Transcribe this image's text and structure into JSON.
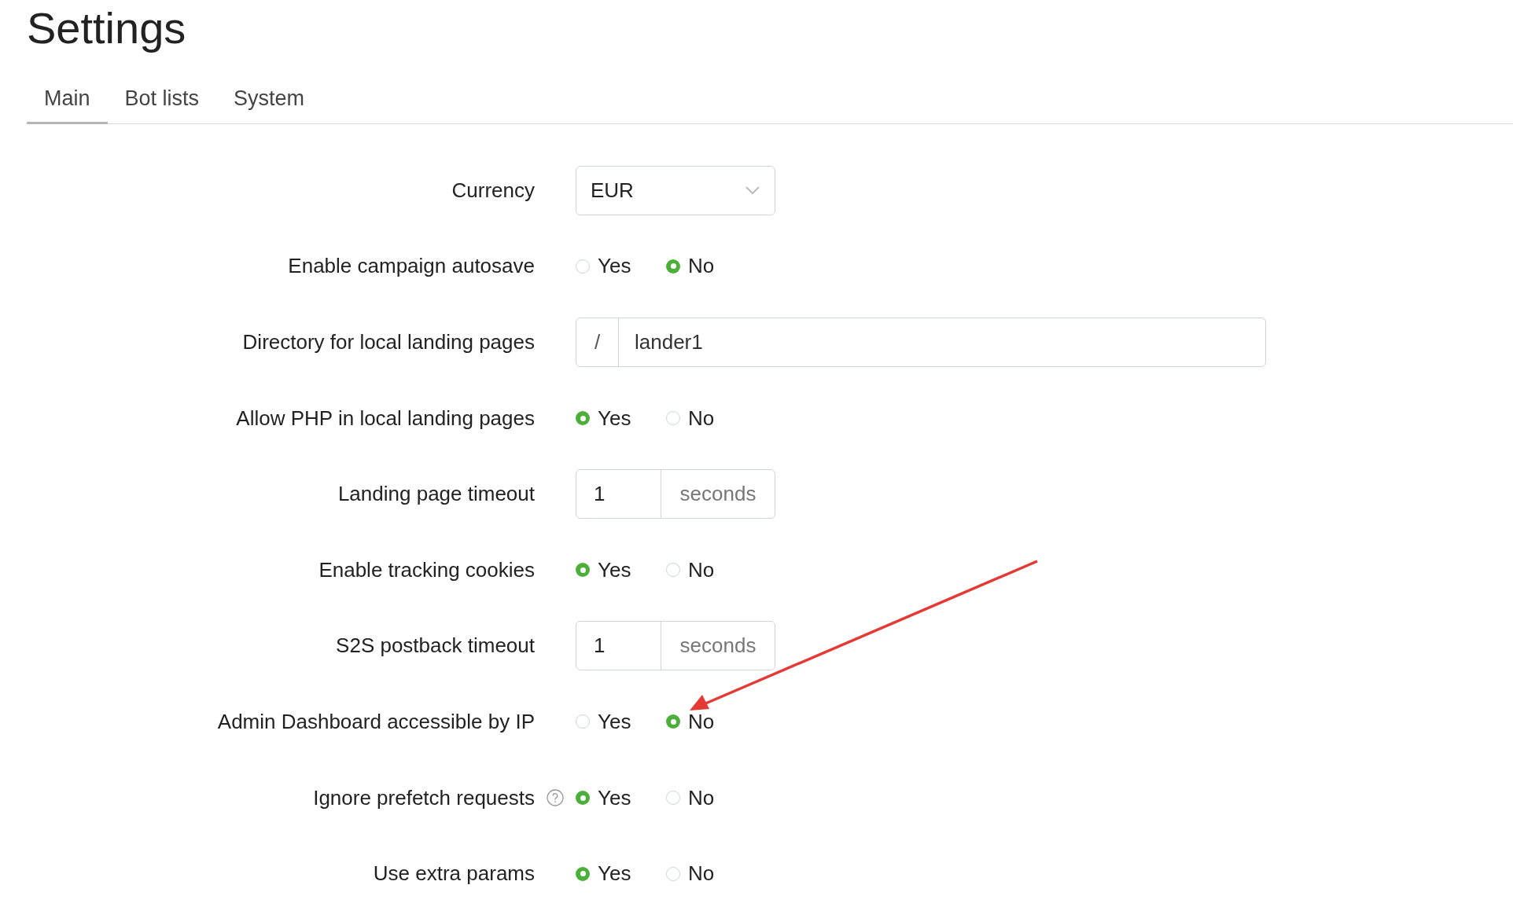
{
  "page": {
    "title": "Settings"
  },
  "tabs": [
    {
      "label": "Main",
      "selected": true
    },
    {
      "label": "Bot lists",
      "selected": false
    },
    {
      "label": "System",
      "selected": false
    }
  ],
  "rows": [
    {
      "kind": "select",
      "label": "Currency",
      "value": "EUR"
    },
    {
      "kind": "radio",
      "label": "Enable campaign autosave",
      "options": [
        {
          "label": "Yes",
          "selected": false
        },
        {
          "label": "No",
          "selected": true
        }
      ]
    },
    {
      "kind": "prefix_input",
      "label": "Directory for local landing pages",
      "prefix": "/",
      "value": "lander1"
    },
    {
      "kind": "radio",
      "label": "Allow PHP in local landing pages",
      "options": [
        {
          "label": "Yes",
          "selected": true
        },
        {
          "label": "No",
          "selected": false
        }
      ]
    },
    {
      "kind": "suffix_input",
      "label": "Landing page timeout",
      "value": "1",
      "suffix": "seconds"
    },
    {
      "kind": "radio",
      "label": "Enable tracking cookies",
      "options": [
        {
          "label": "Yes",
          "selected": true
        },
        {
          "label": "No",
          "selected": false
        }
      ]
    },
    {
      "kind": "suffix_input",
      "label": "S2S postback timeout",
      "value": "1",
      "suffix": "seconds"
    },
    {
      "kind": "radio",
      "label": "Admin Dashboard accessible by IP",
      "options": [
        {
          "label": "Yes",
          "selected": false
        },
        {
          "label": "No",
          "selected": true
        }
      ]
    },
    {
      "kind": "radio",
      "label": "Ignore prefetch requests",
      "help": true,
      "options": [
        {
          "label": "Yes",
          "selected": true
        },
        {
          "label": "No",
          "selected": false
        }
      ]
    },
    {
      "kind": "radio",
      "label": "Use extra params",
      "options": [
        {
          "label": "Yes",
          "selected": true
        },
        {
          "label": "No",
          "selected": false
        }
      ]
    }
  ]
}
